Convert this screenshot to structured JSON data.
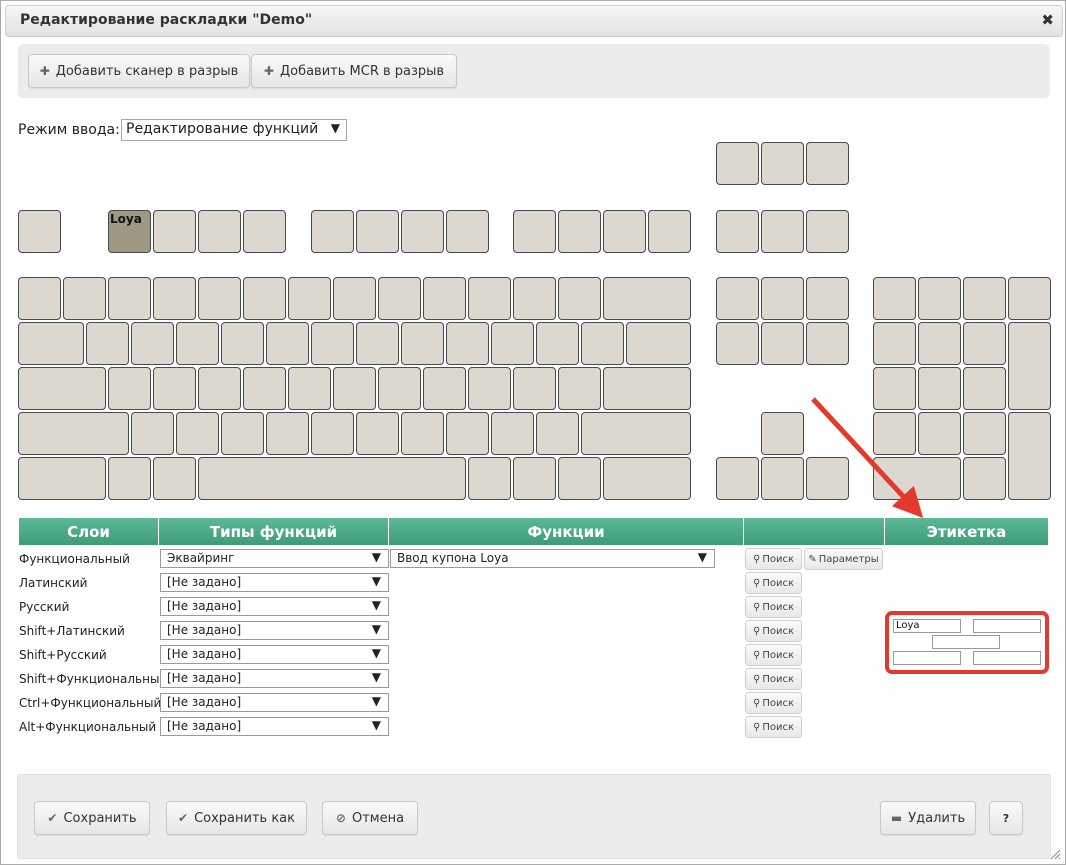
{
  "title": "Редактирование раскладки \"Demo\"",
  "close_glyph": "✖",
  "toolbar": {
    "add_scanner": "Добавить сканер в разрыв",
    "add_mcr": "Добавить MCR в разрыв",
    "plus_glyph": "✚"
  },
  "mode": {
    "label": "Режим ввода:",
    "value": "Редактирование функций",
    "arrow": "▼"
  },
  "keyboard": {
    "active_key_label": "Loya"
  },
  "table": {
    "headers": {
      "layers": "Слои",
      "types": "Типы функций",
      "functions": "Функции",
      "actions": "",
      "label": "Этикетка"
    },
    "rows": [
      {
        "layer": "Функциональный",
        "type": "Эквайринг",
        "function": "Ввод купона Loya"
      },
      {
        "layer": "Латинский",
        "type": "[Не задано]"
      },
      {
        "layer": "Русский",
        "type": "[Не задано]"
      },
      {
        "layer": "Shift+Латинский",
        "type": "[Не задано]"
      },
      {
        "layer": "Shift+Русский",
        "type": "[Не задано]"
      },
      {
        "layer": "Shift+Функциональный",
        "type": "[Не задано]"
      },
      {
        "layer": "Ctrl+Функциональный",
        "type": "[Не задано]"
      },
      {
        "layer": "Alt+Функциональный",
        "type": "[Не задано]"
      }
    ],
    "search_label": "Поиск",
    "params_label": "Параметры",
    "search_glyph": "⚲",
    "params_glyph": "✎"
  },
  "etiquette": {
    "line1_left": "Loya",
    "line1_right": "",
    "line2": "",
    "line3_left": "",
    "line3_right": ""
  },
  "footer": {
    "save": "Сохранить",
    "save_as": "Сохранить как",
    "cancel": "Отмена",
    "delete": "Удалить",
    "help": "?",
    "save_glyph": "✔",
    "save_as_glyph": "✔",
    "cancel_glyph": "⊘",
    "delete_glyph": "▬"
  },
  "colors": {
    "header_green": "#4aa884",
    "key_fill": "#dcd8cf",
    "key_active": "#9e9884",
    "highlight_red": "#e23a2e"
  }
}
